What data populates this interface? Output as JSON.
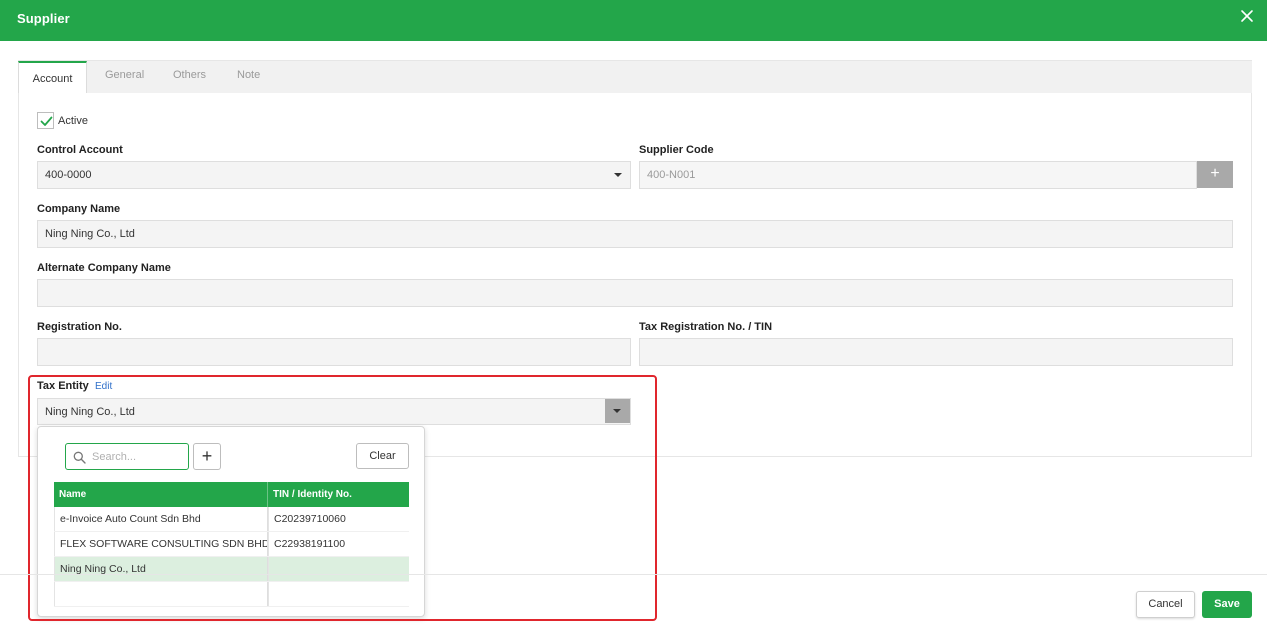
{
  "header": {
    "title": "Supplier",
    "close_icon": "close-icon"
  },
  "tabs": [
    {
      "label": "Account",
      "active": true
    },
    {
      "label": "General",
      "active": false
    },
    {
      "label": "Others",
      "active": false
    },
    {
      "label": "Note",
      "active": false
    }
  ],
  "form": {
    "active_label": "Active",
    "active_checked": true,
    "control_account": {
      "label": "Control Account",
      "value": "400-0000"
    },
    "supplier_code": {
      "label": "Supplier Code",
      "value": "400-N001",
      "button": "+"
    },
    "company_name": {
      "label": "Company Name",
      "value": "Ning Ning Co., Ltd"
    },
    "alternate_company_name": {
      "label": "Alternate Company Name",
      "value": ""
    },
    "registration_no": {
      "label": "Registration No.",
      "value": ""
    },
    "tax_registration_no": {
      "label": "Tax Registration No. / TIN",
      "value": ""
    },
    "tax_entity": {
      "label": "Tax Entity",
      "edit_label": "Edit",
      "value": "Ning Ning Co., Ltd"
    }
  },
  "popup": {
    "search_placeholder": "Search...",
    "add_button": "+",
    "clear_button": "Clear",
    "columns": [
      "Name",
      "TIN / Identity No."
    ],
    "rows": [
      {
        "name": "e-Invoice Auto Count Sdn Bhd",
        "tin": "C20239710060",
        "selected": false
      },
      {
        "name": "FLEX SOFTWARE CONSULTING SDN BHD",
        "tin": "C22938191100",
        "selected": false
      },
      {
        "name": "Ning Ning Co., Ltd",
        "tin": "",
        "selected": true
      },
      {
        "name": "",
        "tin": "",
        "selected": false
      }
    ]
  },
  "footer": {
    "cancel_label": "Cancel",
    "save_label": "Save"
  },
  "colors": {
    "accent": "#23a64a",
    "highlight": "#e0262d",
    "link": "#2f6fc9"
  }
}
